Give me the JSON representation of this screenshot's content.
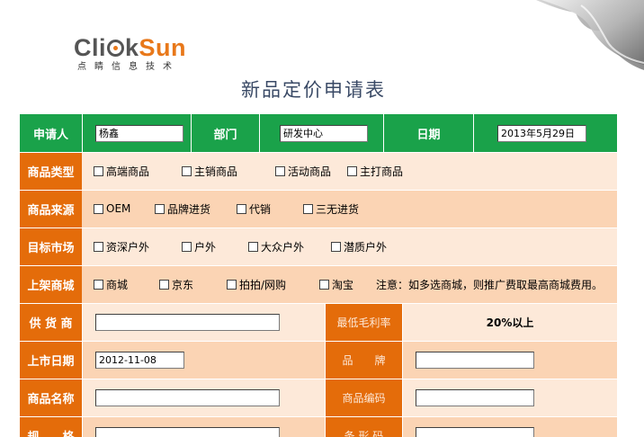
{
  "logo": {
    "part1": "Cli",
    "part2": "k",
    "part3": "Sun",
    "subtitle": "点睛信息技术"
  },
  "title": "新品定价申请表",
  "header_row": {
    "applicant_label": "申请人",
    "applicant_value": "杨鑫",
    "dept_label": "部门",
    "dept_value": "研发中心",
    "date_label": "日期",
    "date_value": "2013年5月29日"
  },
  "product_type": {
    "label": "商品类型",
    "options": [
      "高端商品",
      "主销商品",
      "活动商品",
      "主打商品"
    ]
  },
  "product_source": {
    "label": "商品来源",
    "options": [
      "OEM",
      "品牌进货",
      "代销",
      "三无进货"
    ]
  },
  "target_market": {
    "label": "目标市场",
    "options": [
      "资深户外",
      "户外",
      "大众户外",
      "潜质户外"
    ]
  },
  "listing_mall": {
    "label": "上架商城",
    "options": [
      "商城",
      "京东",
      "拍拍/网购",
      "淘宝"
    ],
    "note": "注意：如多选商城，则推广费取最高商城费用。"
  },
  "supplier": {
    "label": "供 货 商",
    "value": "",
    "margin_label": "最低毛利率",
    "margin_value": "20%以上"
  },
  "launch": {
    "label": "上市日期",
    "value": "2012-11-08",
    "brand_label": "品　　牌",
    "brand_value": ""
  },
  "product": {
    "name_label": "商品名称",
    "name_value": "",
    "code_label": "商品编码",
    "code_value": ""
  },
  "spec": {
    "label": "规　　格",
    "barcode_label": "条 形 码"
  },
  "colors": {
    "green": "#1aa24a",
    "orange": "#e46c0a",
    "peach": "#fbd4b4",
    "light": "#fde9d9"
  }
}
